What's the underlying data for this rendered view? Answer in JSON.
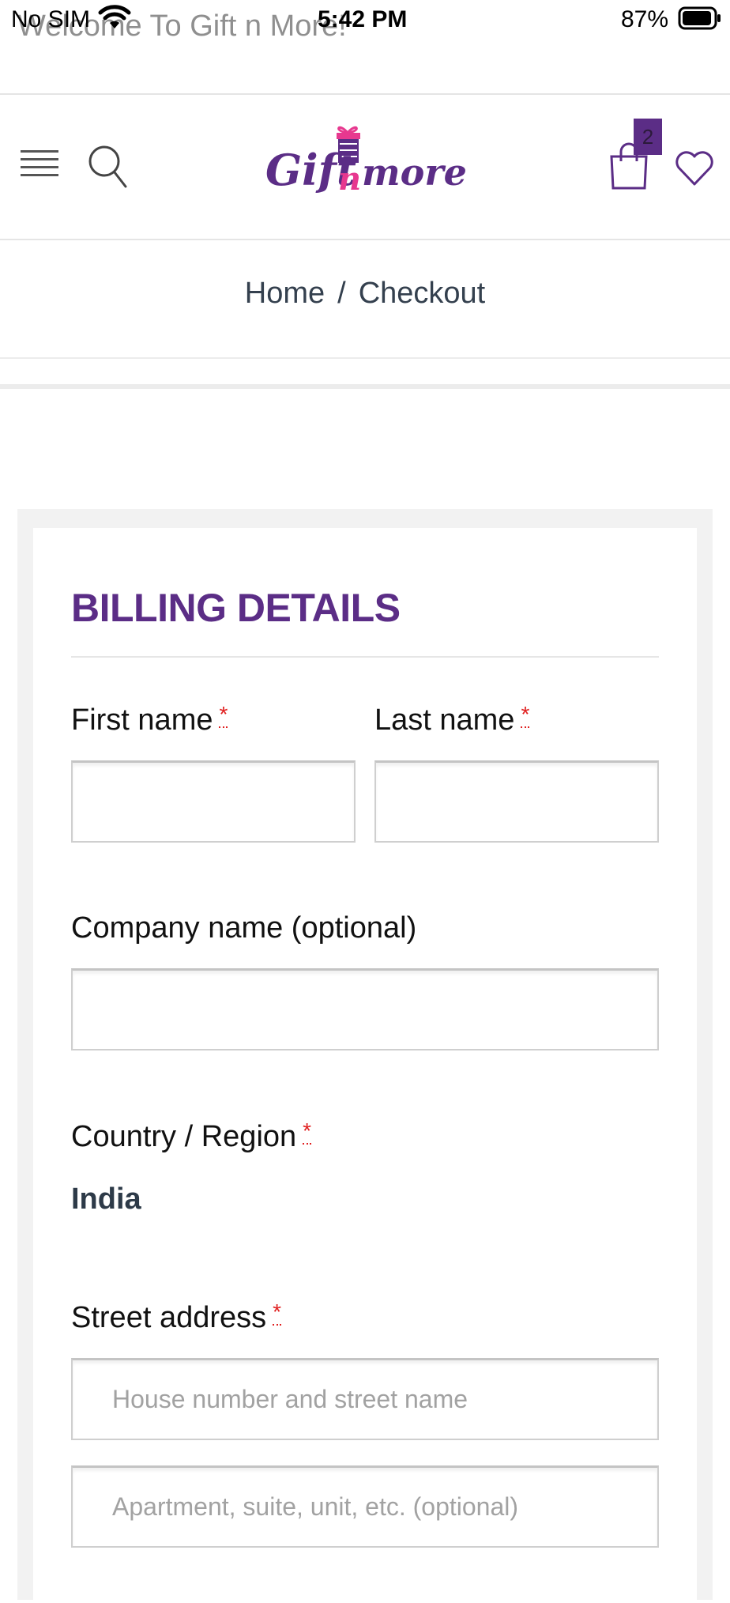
{
  "status_bar": {
    "carrier": "No SIM",
    "time": "5:42 PM",
    "battery": "87%",
    "icons": [
      "wifi-icon",
      "battery-icon"
    ]
  },
  "welcome": "Welcome To Gift n More!",
  "header": {
    "logo_text": "Gift n more",
    "cart_count": "2",
    "icons": [
      "menu-icon",
      "search-icon",
      "logo-gift-icon",
      "shopping-bag-icon",
      "heart-icon"
    ]
  },
  "breadcrumb": {
    "home": "Home",
    "separator": "/",
    "current": "Checkout"
  },
  "billing": {
    "title": "BILLING DETAILS",
    "required_mark": "*",
    "first_name_label": "First name",
    "last_name_label": "Last name",
    "first_name_value": "",
    "last_name_value": "",
    "company_label": "Company name (optional)",
    "company_value": "",
    "country_label": "Country / Region",
    "country_value": "India",
    "street_label": "Street address",
    "street_placeholder_1": "House number and street name",
    "street_placeholder_2": "Apartment, suite, unit, etc. (optional)",
    "street_value_1": "",
    "street_value_2": ""
  },
  "colors": {
    "brand_purple": "#5b2d86",
    "required_red": "#e02020",
    "breadcrumb_text": "#34404e"
  }
}
